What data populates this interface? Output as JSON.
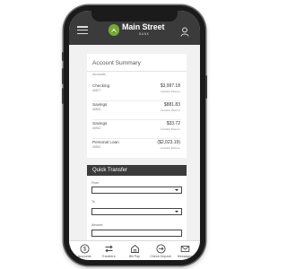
{
  "header": {
    "brand_name": "Main Street",
    "brand_sub": "BANK"
  },
  "summary": {
    "title": "Account Summary",
    "section_label": "Accounts",
    "accounts": [
      {
        "name": "Checking",
        "number": "#6877",
        "balance": "$3,997.18",
        "available": "Available Balance"
      },
      {
        "name": "Savings",
        "number": "#6800",
        "balance": "$881.83",
        "available": "Available Balance"
      },
      {
        "name": "Savings",
        "number": "#8542",
        "balance": "$33.72",
        "available": "Available Balance"
      },
      {
        "name": "Personal Loan",
        "number": "#8861",
        "balance": "($2,023.19)",
        "available": "Available Balance"
      }
    ]
  },
  "quick_transfer": {
    "title": "Quick Transfer",
    "from_label": "From",
    "to_label": "To",
    "amount_label": "Amount",
    "from_value": "",
    "to_value": "",
    "amount_value": ""
  },
  "tabbar": {
    "items": [
      {
        "label": "Accounts",
        "icon": "dollar-circle-icon"
      },
      {
        "label": "Transfers",
        "icon": "transfer-arrows-icon"
      },
      {
        "label": "Bill Pay",
        "icon": "bill-pay-icon"
      },
      {
        "label": "Check Deposit",
        "icon": "check-deposit-icon"
      },
      {
        "label": "Messages",
        "icon": "mail-icon"
      }
    ]
  },
  "colors": {
    "topbar": "#3b3b3b",
    "brand_green": "#76a83a",
    "screen_bg": "#f1f1f1"
  }
}
